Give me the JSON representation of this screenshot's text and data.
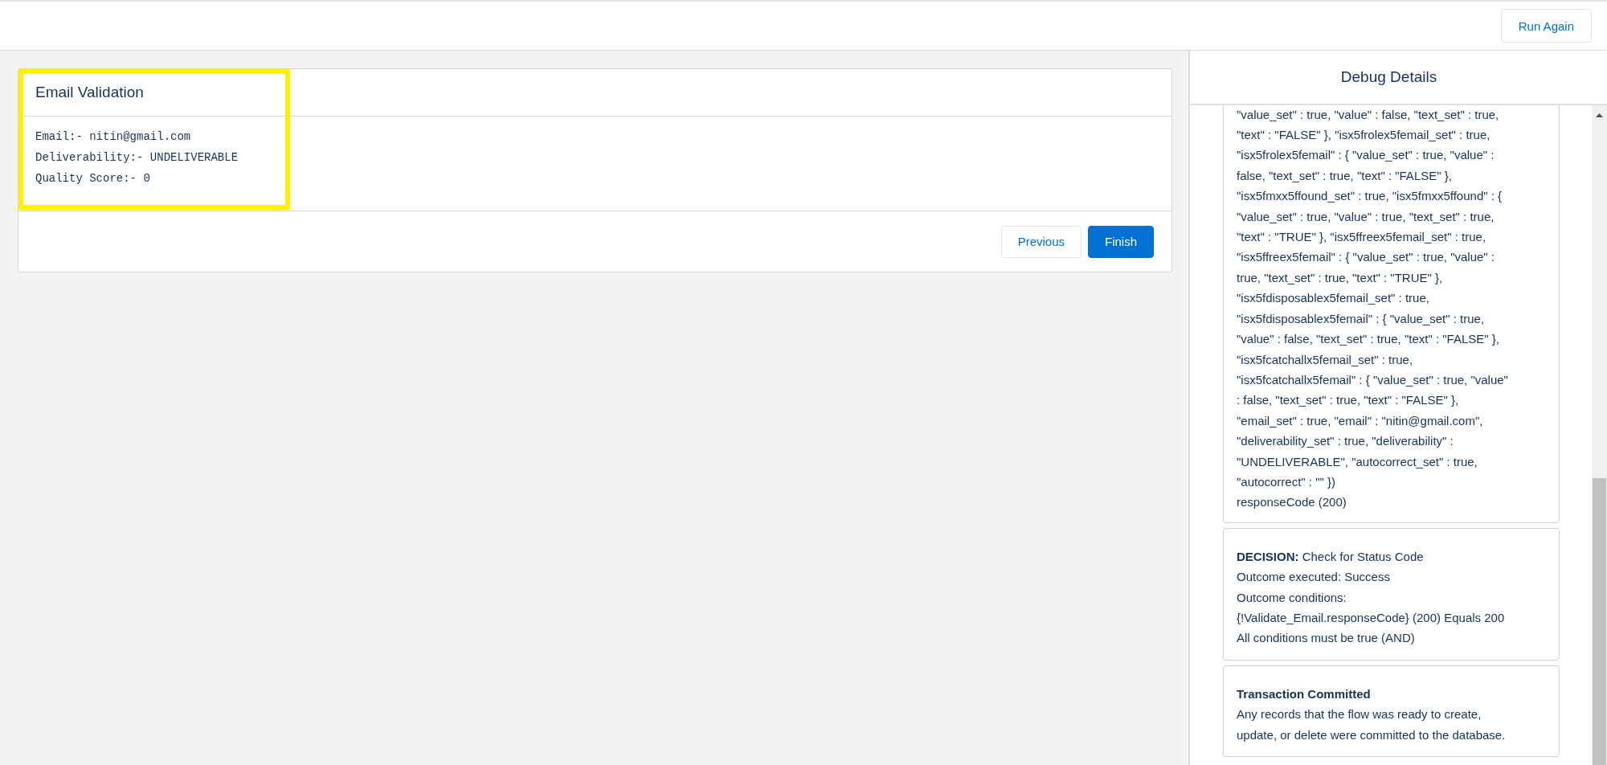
{
  "header": {
    "run_again_button": "Run Again"
  },
  "screen": {
    "title": "Email Validation",
    "lines": [
      "Email:- nitin@gmail.com",
      "Deliverability:- UNDELIVERABLE",
      "Quality Score:- 0"
    ],
    "buttons": [
      {
        "label": "Previous",
        "kind": "neutral"
      },
      {
        "label": "Finish",
        "kind": "brand"
      }
    ]
  },
  "debug": {
    "title": "Debug Details",
    "entries": [
      {
        "kind": "log",
        "lines": [
          "\"value_set\" : true, \"value\" : false, \"text_set\" : true,",
          "\"text\" : \"FALSE\" }, \"isx5frolex5femail_set\" : true,",
          "\"isx5frolex5femail\" : { \"value_set\" : true, \"value\" :",
          "false, \"text_set\" : true, \"text\" : \"FALSE\" },",
          "\"isx5fmxx5ffound_set\" : true, \"isx5fmxx5ffound\" : {",
          "\"value_set\" : true, \"value\" : true, \"text_set\" : true,",
          "\"text\" : \"TRUE\" }, \"isx5ffreex5femail_set\" : true,",
          "\"isx5ffreex5femail\" : { \"value_set\" : true, \"value\" :",
          "true, \"text_set\" : true, \"text\" : \"TRUE\" },",
          "\"isx5fdisposablex5femail_set\" : true,",
          "\"isx5fdisposablex5femail\" : { \"value_set\" : true,",
          "\"value\" : false, \"text_set\" : true, \"text\" : \"FALSE\" },",
          "\"isx5fcatchallx5femail_set\" : true,",
          "\"isx5fcatchallx5femail\" : { \"value_set\" : true, \"value\"",
          ": false, \"text_set\" : true, \"text\" : \"FALSE\" },",
          "\"email_set\" : true, \"email\" : \"nitin@gmail.com\",",
          "\"deliverability_set\" : true, \"deliverability\" :",
          "\"UNDELIVERABLE\", \"autocorrect_set\" : true,",
          "\"autocorrect\" : \"\" })"
        ],
        "footer": "responseCode (200)"
      },
      {
        "kind": "decision",
        "heading": "**DECISION:** Check for Status Code",
        "lines": [
          "Outcome executed: Success",
          "Outcome conditions:",
          "{!Validate_Email.responseCode} (200) Equals 200",
          "All conditions must be true (AND)"
        ]
      },
      {
        "kind": "commit",
        "heading": "Transaction Committed",
        "lines": [
          "Any records that the flow was ready to create,",
          "update, or delete were committed to the database."
        ]
      }
    ]
  }
}
